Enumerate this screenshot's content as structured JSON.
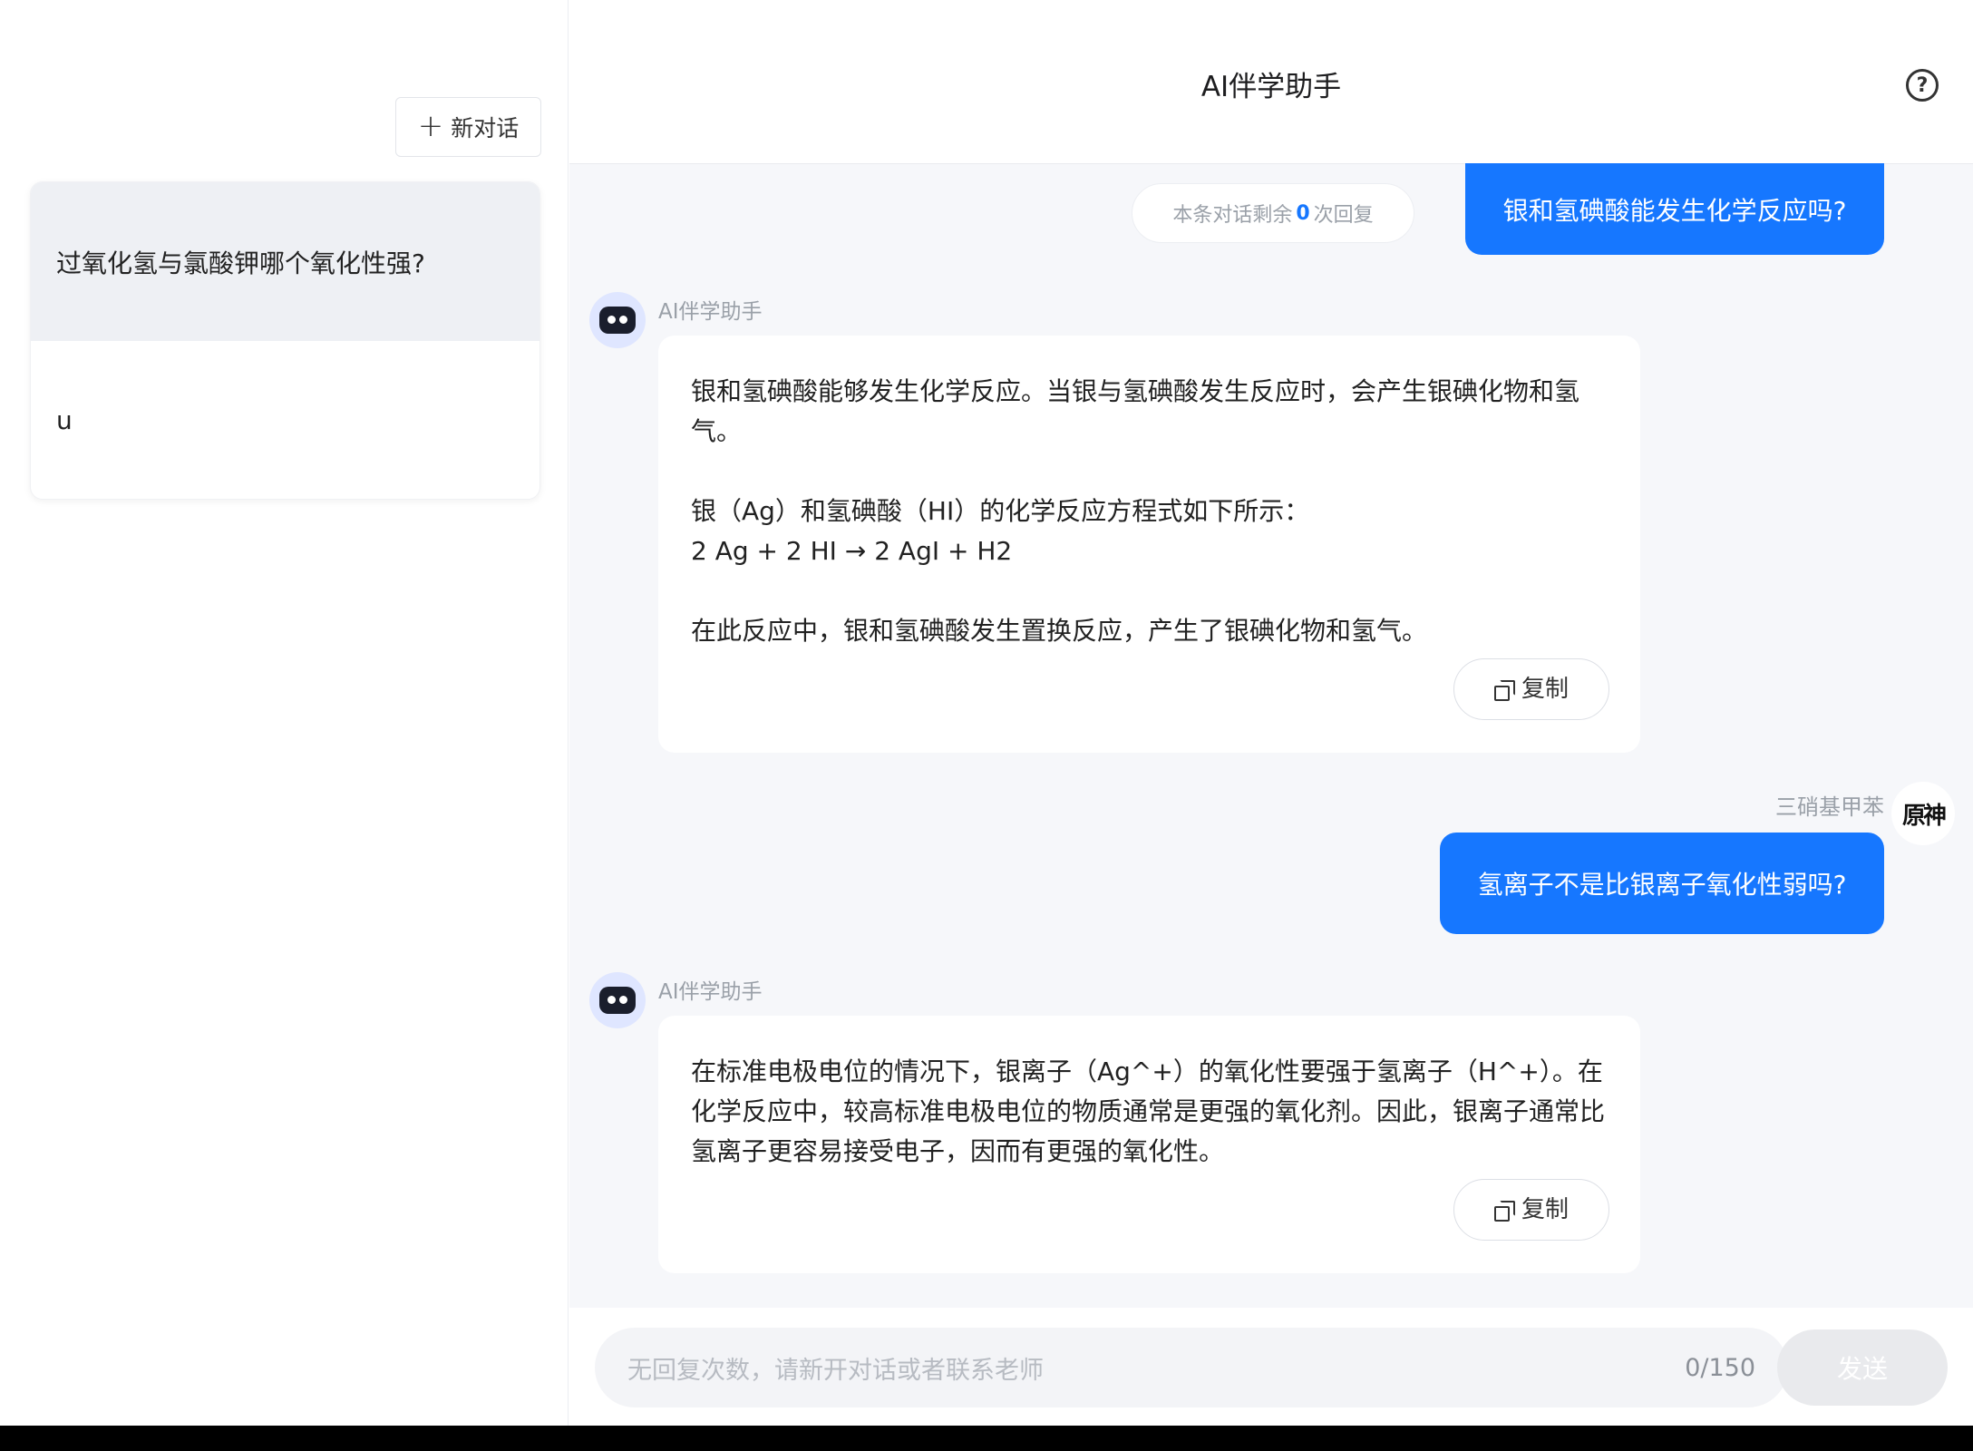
{
  "sidebar": {
    "new_chat_label": "新对话",
    "conversations": [
      {
        "title": "过氧化氢与氯酸钾哪个氧化性强?"
      },
      {
        "title": "u"
      }
    ]
  },
  "header": {
    "title": "AI伴学助手",
    "help_icon": "help-circle-icon"
  },
  "remaining": {
    "prefix": "本条对话剩余",
    "count": "0",
    "suffix": "次回复"
  },
  "messages": {
    "user1": "银和氢碘酸能发生化学反应吗?",
    "ai1": {
      "name": "AI伴学助手",
      "lines": [
        "银和氢碘酸能够发生化学反应。当银与氢碘酸发生反应时，会产生银碘化物和氢气。",
        "银（Ag）和氢碘酸（HI）的化学反应方程式如下所示：",
        "2 Ag + 2 HI → 2 AgI + H2",
        "在此反应中，银和氢碘酸发生置换反应，产生了银碘化物和氢气。"
      ],
      "copy_label": "复制"
    },
    "user2_name": "三硝基甲苯",
    "user2_avatar_text": "原神",
    "user2": "氢离子不是比银离子氧化性弱吗?",
    "ai2": {
      "name": "AI伴学助手",
      "text": "在标准电极电位的情况下，银离子（Ag^+）的氧化性要强于氢离子（H^+）。在化学反应中，较高标准电极电位的物质通常是更强的氧化剂。因此，银离子通常比氢离子更容易接受电子，因而有更强的氧化性。",
      "copy_label": "复制"
    }
  },
  "input": {
    "placeholder": "无回复次数，请新开对话或者联系老师",
    "counter": "0/150",
    "send_label": "发送"
  },
  "colors": {
    "accent": "#1677ff",
    "sidebar_active": "#eef0f4",
    "chat_bg": "#f6f7fa"
  }
}
